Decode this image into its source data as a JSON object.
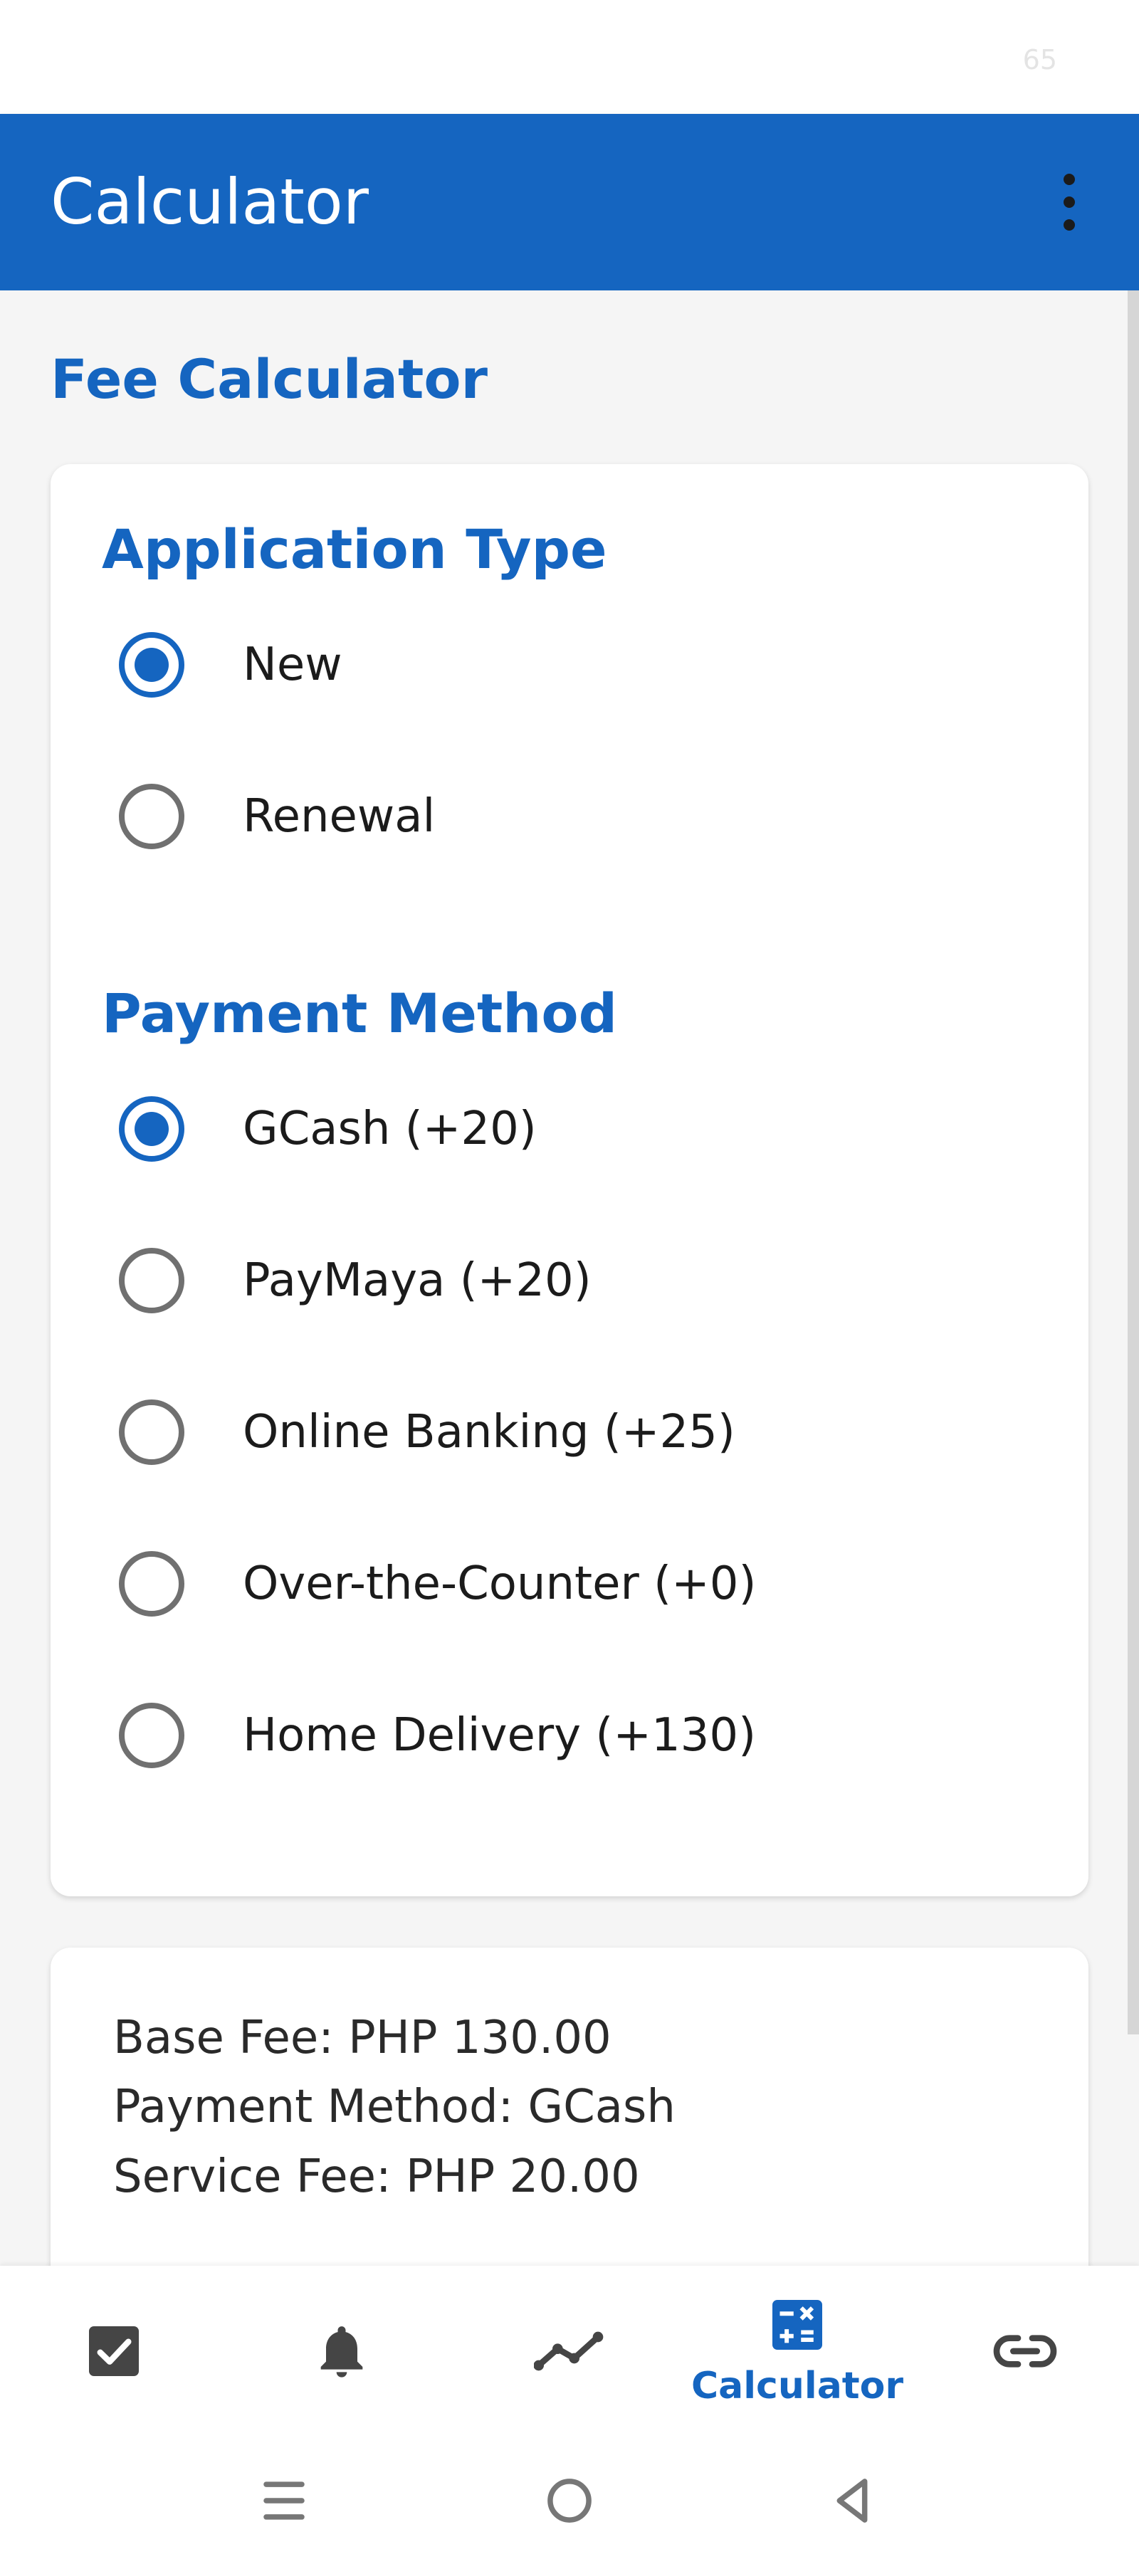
{
  "status_bar": {
    "text": "65"
  },
  "app_bar": {
    "title": "Calculator",
    "menu_icon": "more-vert-icon"
  },
  "main": {
    "section_title": "Fee Calculator",
    "application_type": {
      "title": "Application Type",
      "options": [
        {
          "label": "New",
          "checked": true
        },
        {
          "label": "Renewal",
          "checked": false
        }
      ]
    },
    "payment_method": {
      "title": "Payment Method",
      "options": [
        {
          "label": "GCash (+20)",
          "checked": true
        },
        {
          "label": "PayMaya (+20)",
          "checked": false
        },
        {
          "label": "Online Banking (+25)",
          "checked": false
        },
        {
          "label": "Over-the-Counter (+0)",
          "checked": false
        },
        {
          "label": "Home Delivery (+130)",
          "checked": false
        }
      ]
    },
    "summary": {
      "lines": [
        "Base Fee: PHP 130.00",
        "Payment Method: GCash",
        "Service Fee: PHP 20.00"
      ]
    }
  },
  "bottom_nav": {
    "items": [
      {
        "icon": "checkbox-icon",
        "label": ""
      },
      {
        "icon": "bell-icon",
        "label": ""
      },
      {
        "icon": "trend-line-icon",
        "label": ""
      },
      {
        "icon": "calculator-icon",
        "label": "Calculator",
        "active": true
      },
      {
        "icon": "link-icon",
        "label": ""
      }
    ]
  },
  "colors": {
    "primary": "#1565c0",
    "text": "#1b1b1b",
    "radio_unchecked": "#707070",
    "background": "#f5f5f5"
  }
}
